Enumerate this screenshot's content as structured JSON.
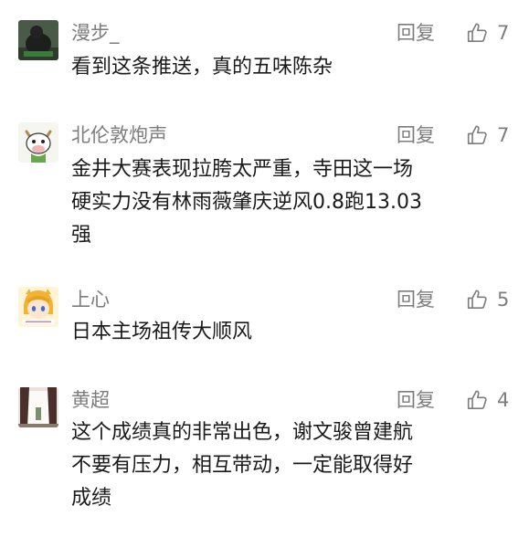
{
  "comments": [
    {
      "username": "漫步_",
      "reply_label": "回复",
      "likes": "7",
      "text_lines": [
        "看到这条推送，真的五味陈杂"
      ],
      "avatar_icon": "dark-figure-avatar-icon"
    },
    {
      "username": "北伦敦炮声",
      "reply_label": "回复",
      "likes": "7",
      "text_lines": [
        "金井大赛表现拉胯太严重，寺田这一场",
        "硬实力没有林雨薇肇庆逆风0.8跑13.03",
        "强"
      ],
      "avatar_icon": "cartoon-cow-avatar-icon"
    },
    {
      "username": "上心",
      "reply_label": "回复",
      "likes": "5",
      "text_lines": [
        "日本主场祖传大顺风"
      ],
      "avatar_icon": "anime-character-avatar-icon"
    },
    {
      "username": "黄超",
      "reply_label": "回复",
      "likes": "4",
      "text_lines": [
        "这个成绩真的非常出色，谢文骏曾建航",
        "不要有压力，相互带动，一定能取得好",
        "成绩"
      ],
      "avatar_icon": "window-curtain-avatar-icon"
    }
  ],
  "colors": {
    "meta_text": "#7d7d7d",
    "body_text": "#1a1a1a",
    "background": "#ffffff"
  }
}
